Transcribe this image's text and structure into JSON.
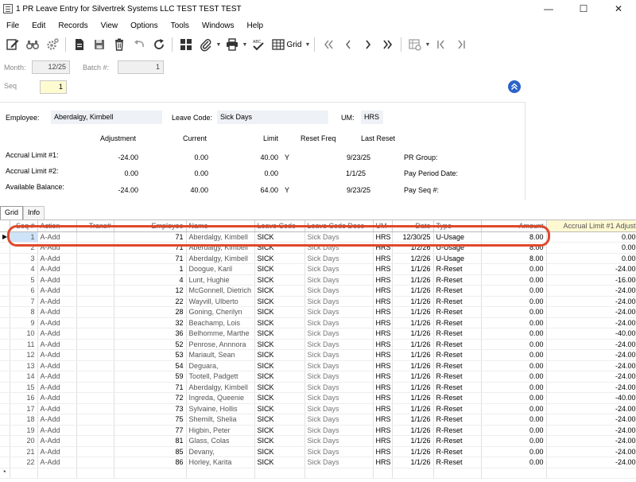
{
  "window": {
    "title": "1 PR Leave Entry for Silvertrek Systems LLC TEST TEST TEST",
    "minimize": "—",
    "maximize": "☐",
    "close": "✕"
  },
  "menu": [
    "File",
    "Edit",
    "Records",
    "View",
    "Options",
    "Tools",
    "Windows",
    "Help"
  ],
  "toolbar": {
    "grid_label": "Grid"
  },
  "header": {
    "month_label": "Month:",
    "month_value": "12/25",
    "batch_label": "Batch #:",
    "batch_value": "1",
    "seq_label": "Seq",
    "seq_value": "1"
  },
  "employee_panel": {
    "employee_label": "Employee:",
    "employee_value": "Aberdalgy, Kimbell",
    "leave_code_label": "Leave Code:",
    "leave_code_value": "Sick Days",
    "um_label": "UM:",
    "um_value": "HRS",
    "col_adjustment": "Adjustment",
    "col_current": "Current",
    "col_limit": "Limit",
    "col_reset_freq": "Reset Freq",
    "col_last_reset": "Last Reset",
    "accrual1_label": "Accrual Limit #1:",
    "accrual1": {
      "adjustment": "-24.00",
      "current": "0.00",
      "limit": "40.00",
      "reset_freq": "Y",
      "last_reset": "9/23/25"
    },
    "accrual2_label": "Accrual Limit #2:",
    "accrual2": {
      "adjustment": "0.00",
      "current": "0.00",
      "limit": "0.00",
      "last_reset": "1/1/25"
    },
    "available_label": "Available Balance:",
    "available": {
      "adjustment": "-24.00",
      "current": "40.00",
      "limit": "64.00",
      "reset_freq": "Y",
      "last_reset": "9/23/25"
    },
    "pr_group_label": "PR Group:",
    "pay_period_label": "Pay Period Date:",
    "pay_seq_label": "Pay Seq #:"
  },
  "tabs": [
    "Grid",
    "Info"
  ],
  "grid": {
    "columns": [
      "Seq #",
      "Action",
      "Trans#",
      "Employee",
      "Name",
      "Leave Code",
      "Leave Code Desc",
      "UM",
      "Date",
      "Type",
      "Amount",
      "Accrual Limit #1 Adjust"
    ],
    "rows": [
      [
        "1",
        "A-Add",
        "",
        "71",
        "Aberdalgy, Kimbell",
        "SICK",
        "Sick Days",
        "HRS",
        "12/30/25",
        "U-Usage",
        "8.00",
        "0.00"
      ],
      [
        "2",
        "A-Add",
        "",
        "71",
        "Aberdalgy, Kimbell",
        "SICK",
        "Sick Days",
        "HRS",
        "1/2/26",
        "U-Usage",
        "8.00",
        "0.00"
      ],
      [
        "3",
        "A-Add",
        "",
        "71",
        "Aberdalgy, Kimbell",
        "SICK",
        "Sick Days",
        "HRS",
        "1/2/26",
        "U-Usage",
        "8.00",
        "0.00"
      ],
      [
        "4",
        "A-Add",
        "",
        "1",
        "Doogue, Karil",
        "SICK",
        "Sick Days",
        "HRS",
        "1/1/26",
        "R-Reset",
        "0.00",
        "-24.00"
      ],
      [
        "5",
        "A-Add",
        "",
        "4",
        "Lunt, Hughie",
        "SICK",
        "Sick Days",
        "HRS",
        "1/1/26",
        "R-Reset",
        "0.00",
        "-16.00"
      ],
      [
        "6",
        "A-Add",
        "",
        "12",
        "McGonnell, Dietrich",
        "SICK",
        "Sick Days",
        "HRS",
        "1/1/26",
        "R-Reset",
        "0.00",
        "-24.00"
      ],
      [
        "7",
        "A-Add",
        "",
        "22",
        "Wayvill, Ulberto",
        "SICK",
        "Sick Days",
        "HRS",
        "1/1/26",
        "R-Reset",
        "0.00",
        "-24.00"
      ],
      [
        "8",
        "A-Add",
        "",
        "28",
        "Goning, Cherilyn",
        "SICK",
        "Sick Days",
        "HRS",
        "1/1/26",
        "R-Reset",
        "0.00",
        "-24.00"
      ],
      [
        "9",
        "A-Add",
        "",
        "32",
        "Beachamp, Lois",
        "SICK",
        "Sick Days",
        "HRS",
        "1/1/26",
        "R-Reset",
        "0.00",
        "-24.00"
      ],
      [
        "10",
        "A-Add",
        "",
        "36",
        "Belhomme, Marthe",
        "SICK",
        "Sick Days",
        "HRS",
        "1/1/26",
        "R-Reset",
        "0.00",
        "-40.00"
      ],
      [
        "11",
        "A-Add",
        "",
        "52",
        "Penrose, Annnora",
        "SICK",
        "Sick Days",
        "HRS",
        "1/1/26",
        "R-Reset",
        "0.00",
        "-24.00"
      ],
      [
        "12",
        "A-Add",
        "",
        "53",
        "Mariault, Sean",
        "SICK",
        "Sick Days",
        "HRS",
        "1/1/26",
        "R-Reset",
        "0.00",
        "-24.00"
      ],
      [
        "13",
        "A-Add",
        "",
        "54",
        "Deguara,",
        "SICK",
        "Sick Days",
        "HRS",
        "1/1/26",
        "R-Reset",
        "0.00",
        "-24.00"
      ],
      [
        "14",
        "A-Add",
        "",
        "59",
        "Tootell, Padgett",
        "SICK",
        "Sick Days",
        "HRS",
        "1/1/26",
        "R-Reset",
        "0.00",
        "-24.00"
      ],
      [
        "15",
        "A-Add",
        "",
        "71",
        "Aberdalgy, Kimbell",
        "SICK",
        "Sick Days",
        "HRS",
        "1/1/26",
        "R-Reset",
        "0.00",
        "-24.00"
      ],
      [
        "16",
        "A-Add",
        "",
        "72",
        "Ingreda, Queenie",
        "SICK",
        "Sick Days",
        "HRS",
        "1/1/26",
        "R-Reset",
        "0.00",
        "-40.00"
      ],
      [
        "17",
        "A-Add",
        "",
        "73",
        "Sylvaine, Hollis",
        "SICK",
        "Sick Days",
        "HRS",
        "1/1/26",
        "R-Reset",
        "0.00",
        "-24.00"
      ],
      [
        "18",
        "A-Add",
        "",
        "75",
        "Shemilt, Shelia",
        "SICK",
        "Sick Days",
        "HRS",
        "1/1/26",
        "R-Reset",
        "0.00",
        "-24.00"
      ],
      [
        "19",
        "A-Add",
        "",
        "77",
        "Higbin, Peter",
        "SICK",
        "Sick Days",
        "HRS",
        "1/1/26",
        "R-Reset",
        "0.00",
        "-24.00"
      ],
      [
        "20",
        "A-Add",
        "",
        "81",
        "Glass, Colas",
        "SICK",
        "Sick Days",
        "HRS",
        "1/1/26",
        "R-Reset",
        "0.00",
        "-24.00"
      ],
      [
        "21",
        "A-Add",
        "",
        "85",
        "Devany,",
        "SICK",
        "Sick Days",
        "HRS",
        "1/1/26",
        "R-Reset",
        "0.00",
        "-24.00"
      ],
      [
        "22",
        "A-Add",
        "",
        "86",
        "Horley, Karita",
        "SICK",
        "Sick Days",
        "HRS",
        "1/1/26",
        "R-Reset",
        "0.00",
        "-24.00"
      ]
    ],
    "current_row_marker": "▶",
    "new_row_marker": "*"
  },
  "colors": {
    "highlight_ring": "#e0492b",
    "selected_cell": "#cfe3f8",
    "yellow_field": "#fffbd0"
  }
}
